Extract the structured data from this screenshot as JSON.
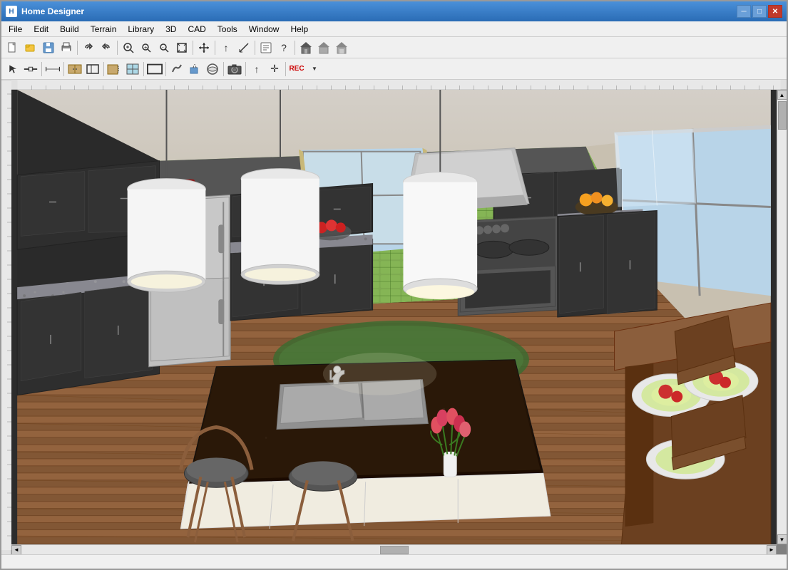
{
  "window": {
    "title": "Home Designer",
    "icon": "H"
  },
  "title_controls": {
    "minimize": "─",
    "maximize": "□",
    "close": "✕"
  },
  "menu": {
    "items": [
      "File",
      "Edit",
      "Build",
      "Terrain",
      "Library",
      "3D",
      "CAD",
      "Tools",
      "Window",
      "Help"
    ]
  },
  "toolbar1": {
    "buttons": [
      {
        "name": "new",
        "icon": "📄"
      },
      {
        "name": "open",
        "icon": "📂"
      },
      {
        "name": "save",
        "icon": "💾"
      },
      {
        "name": "print",
        "icon": "🖨"
      },
      {
        "name": "undo",
        "icon": "↩"
      },
      {
        "name": "redo",
        "icon": "↪"
      },
      {
        "name": "zoom-in-area",
        "icon": "🔍"
      },
      {
        "name": "zoom-in",
        "icon": "+"
      },
      {
        "name": "zoom-out",
        "icon": "−"
      },
      {
        "name": "fit-screen",
        "icon": "⊡"
      },
      {
        "name": "pan",
        "icon": "✋"
      },
      {
        "name": "up-arrow",
        "icon": "⬆"
      },
      {
        "name": "measure",
        "icon": "📐"
      },
      {
        "name": "toolbar-item1",
        "icon": "⬜"
      },
      {
        "name": "help",
        "icon": "?"
      },
      {
        "name": "house-front",
        "icon": "🏠"
      },
      {
        "name": "house-back",
        "icon": "⌂"
      },
      {
        "name": "house-side",
        "icon": "▦"
      }
    ]
  },
  "toolbar2": {
    "buttons": [
      {
        "name": "select",
        "icon": "↖"
      },
      {
        "name": "wall-tool",
        "icon": "⌐"
      },
      {
        "name": "dimension",
        "icon": "↔"
      },
      {
        "name": "cabinet",
        "icon": "▦"
      },
      {
        "name": "stair",
        "icon": "▤"
      },
      {
        "name": "door",
        "icon": "▭"
      },
      {
        "name": "window-tool",
        "icon": "▢"
      },
      {
        "name": "room",
        "icon": "⬛"
      },
      {
        "name": "terrain2",
        "icon": "∿"
      },
      {
        "name": "plant",
        "icon": "✿"
      },
      {
        "name": "camera",
        "icon": "📷"
      },
      {
        "name": "up-arrow2",
        "icon": "↑"
      },
      {
        "name": "move",
        "icon": "✛"
      },
      {
        "name": "record",
        "icon": "⏺"
      }
    ]
  },
  "scrollbar": {
    "up_arrow": "▲",
    "down_arrow": "▼",
    "left_arrow": "◄",
    "right_arrow": "►"
  }
}
